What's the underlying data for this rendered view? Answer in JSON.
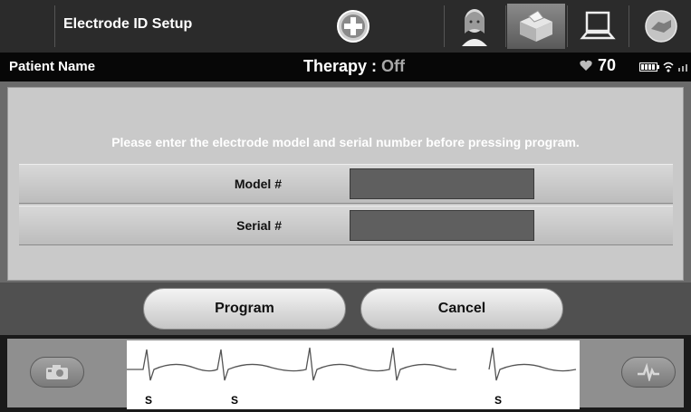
{
  "toolbar": {
    "title": "Electrode ID Setup",
    "icons": [
      "add-icon",
      "clinician-icon",
      "electrode-package-icon",
      "monitor-icon",
      "handshake-icon"
    ]
  },
  "status": {
    "patient_name": "Patient Name",
    "therapy_label": "Therapy : ",
    "therapy_value": "Off",
    "heart_rate": "70"
  },
  "form": {
    "instruction": "Please enter the electrode model and serial number before pressing program.",
    "model_label": "Model #",
    "model_value": "",
    "serial_label": "Serial #",
    "serial_value": ""
  },
  "actions": {
    "program_label": "Program",
    "cancel_label": "Cancel"
  },
  "ecg": {
    "sense_marker": "S",
    "marker_count": 3
  }
}
